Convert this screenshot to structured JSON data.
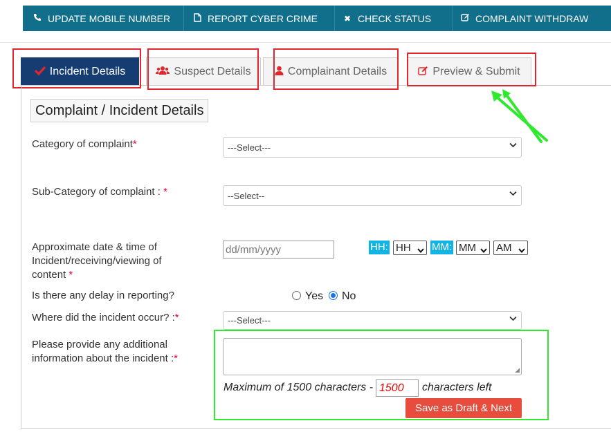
{
  "topnav": {
    "items": [
      {
        "label": "UPDATE MOBILE NUMBER",
        "icon": "phone-icon"
      },
      {
        "label": "REPORT CYBER CRIME",
        "icon": "document-icon"
      },
      {
        "label": "CHECK STATUS",
        "icon": "close-icon"
      },
      {
        "label": "COMPLAINT WITHDRAW",
        "icon": "edit-icon"
      }
    ]
  },
  "tabs": [
    {
      "label": "Incident Details",
      "icon": "check-icon",
      "active": true
    },
    {
      "label": "Suspect Details",
      "icon": "users-icon",
      "active": false
    },
    {
      "label": "Complainant Details",
      "icon": "user-icon",
      "active": false
    },
    {
      "label": "Preview & Submit",
      "icon": "edit-icon",
      "active": false
    }
  ],
  "form": {
    "legend": "Complaint / Incident Details",
    "category": {
      "label": "Category of complaint",
      "required": "*",
      "value": "---Select---"
    },
    "subcategory": {
      "label": "Sub-Category of complaint : ",
      "required": "*",
      "value": "--Select--"
    },
    "datetime": {
      "label": "Approximate date & time of Incident/receiving/viewing of content ",
      "required": "*",
      "date_placeholder": "dd/mm/yyyy",
      "hh_tag": "HH:",
      "hh_value": "HH",
      "mm_tag": "MM:",
      "mm_value": "MM",
      "ampm_value": "AM"
    },
    "delay": {
      "label": "Is there any delay in reporting?",
      "yes": "Yes",
      "no": "No",
      "selected": "No"
    },
    "location": {
      "label": "Where did the incident occur? :",
      "required": "*",
      "value": "---Select---"
    },
    "additional": {
      "label": "Please provide any additional information about the incident :",
      "required": "*",
      "value": ""
    },
    "counter": {
      "prefix": "Maximum of 1500 characters -",
      "value": "1500",
      "suffix": "characters left"
    },
    "save_button": "Save as Draft & Next"
  },
  "annotation_colors": {
    "red_box": "#e2262b",
    "green_box": "#2fe82f"
  },
  "colors": {
    "nav_bg": "#126f8c",
    "active_tab": "#153d72",
    "tag_bg": "#11b4e3",
    "button": "#e74c3c"
  }
}
